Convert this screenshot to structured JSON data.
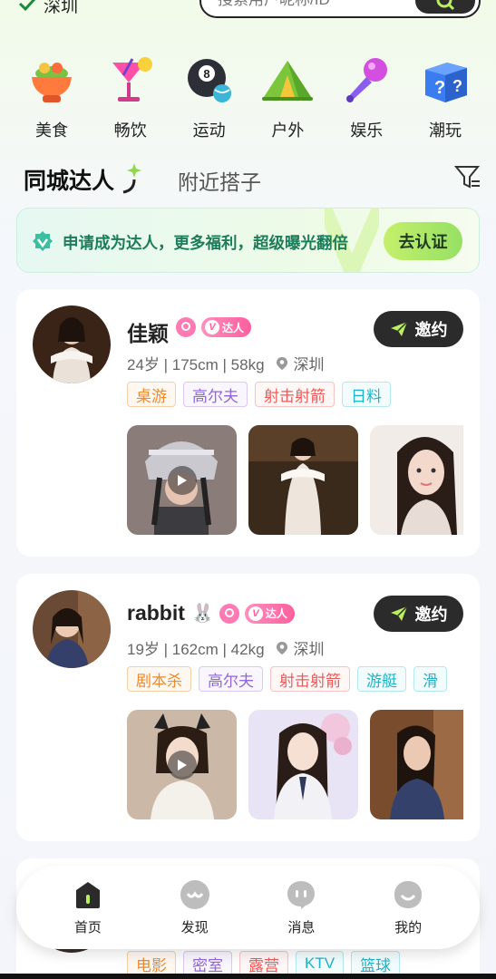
{
  "location": {
    "city": "深圳"
  },
  "search": {
    "placeholder": "搜索用户昵称/ID"
  },
  "categories": [
    {
      "label": "美食",
      "icon": "food-pot-icon"
    },
    {
      "label": "畅饮",
      "icon": "cocktail-icon"
    },
    {
      "label": "运动",
      "icon": "billiard-ball-icon"
    },
    {
      "label": "户外",
      "icon": "tent-icon"
    },
    {
      "label": "娱乐",
      "icon": "microphone-icon"
    },
    {
      "label": "潮玩",
      "icon": "mystery-box-icon"
    }
  ],
  "tabs": {
    "active": "同城达人",
    "other": "附近搭子"
  },
  "banner": {
    "text": "申请成为达人，更多福利，超级曝光翻倍",
    "button": "去认证"
  },
  "cards": [
    {
      "name": "佳颖",
      "daren_label": "达人",
      "meta": "24岁 | 175cm | 58kg",
      "city": "深圳",
      "invite": "邀约",
      "tags": [
        "桌游",
        "高尔夫",
        "射击射箭",
        "日料"
      ]
    },
    {
      "name": "rabbit",
      "name_emoji": "🐰",
      "daren_label": "达人",
      "meta": "19岁 | 162cm | 42kg",
      "city": "深圳",
      "invite": "邀约",
      "tags": [
        "剧本杀",
        "高尔夫",
        "射击射箭",
        "游艇",
        "滑"
      ]
    },
    {
      "tags": [
        "电影",
        "密室",
        "露营",
        "KTV",
        "篮球"
      ]
    }
  ],
  "tabbar": [
    {
      "label": "首页",
      "icon": "home-icon",
      "active": true
    },
    {
      "label": "发现",
      "icon": "discover-icon"
    },
    {
      "label": "消息",
      "icon": "message-icon"
    },
    {
      "label": "我的",
      "icon": "profile-icon"
    }
  ],
  "colors": {
    "accent_green": "#96e064",
    "dark": "#2b2b2b",
    "pink": "#ff5f9d"
  }
}
